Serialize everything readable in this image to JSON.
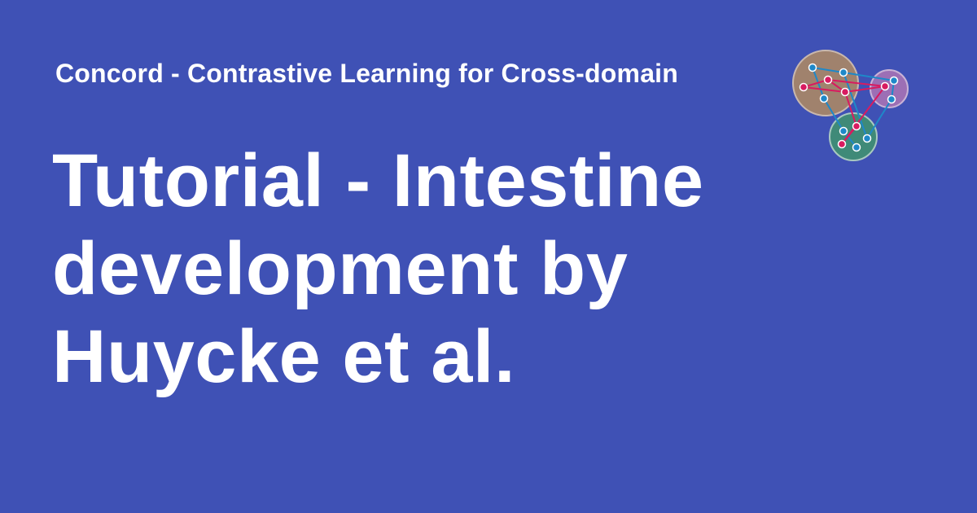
{
  "header": {
    "site_name": "Concord - Contrastive Learning for Cross-domain"
  },
  "main": {
    "title_lines": [
      "Tutorial - Intestine",
      "development by",
      "Huycke et al."
    ]
  },
  "logo": {
    "icon": "concord-network-logo",
    "colors": {
      "cluster_a": "#a0826d",
      "cluster_b": "#9c6fb5",
      "cluster_c": "#3f8a78",
      "node_blue": "#1e88c9",
      "node_red": "#d81b60",
      "edge_blue": "#1e88c9",
      "edge_red": "#d81b60"
    }
  },
  "theme": {
    "background": "#3f51b5",
    "text": "#ffffff"
  }
}
